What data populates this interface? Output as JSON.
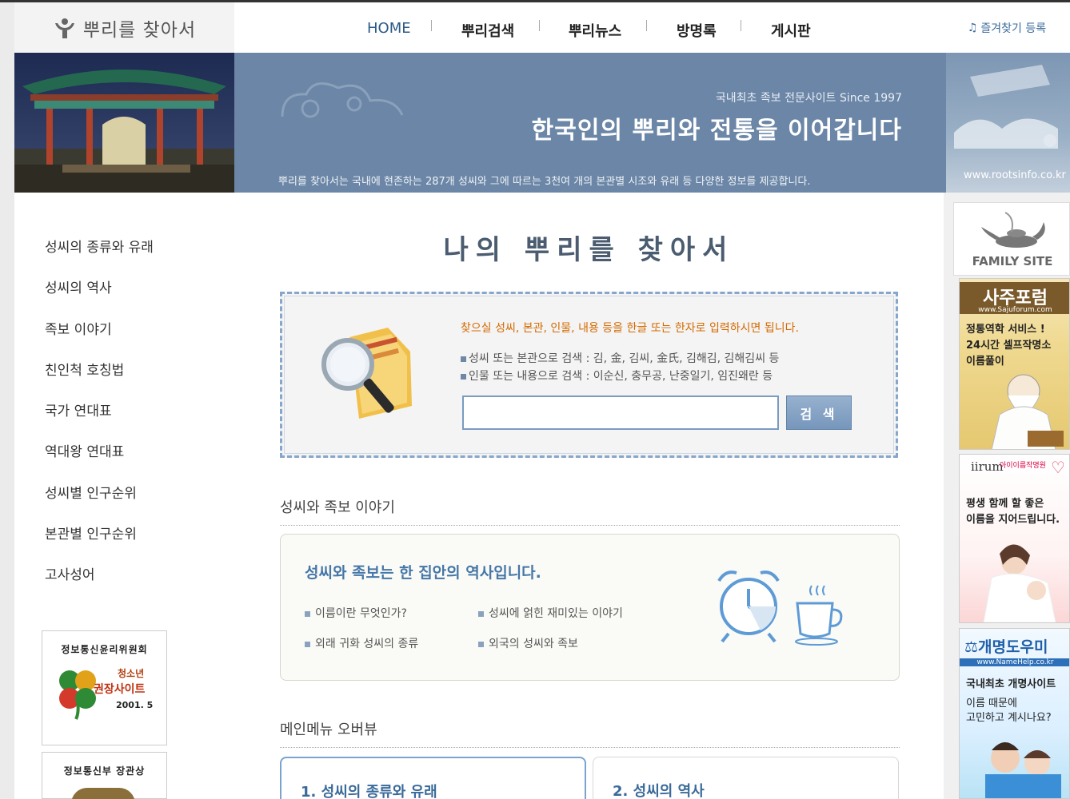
{
  "header": {
    "logo_text": "뿌리를 찾아서",
    "nav": [
      "HOME",
      "뿌리검색",
      "뿌리뉴스",
      "방명록",
      "게시판"
    ],
    "favorite_label": "즐겨찾기 등록"
  },
  "banner": {
    "subtitle": "국내최초 족보 전문사이트 Since 1997",
    "title": "한국인의 뿌리와 전통을 이어갑니다",
    "description": "뿌리를 찾아서는 국내에 현존하는 287개 성씨와 그에 따르는 3천여 개의 본관별 시조와 유래 등 다양한 정보를 제공합니다.",
    "url": "www.rootsinfo.co.kr"
  },
  "sidebar": {
    "items": [
      "성씨의 종류와 유래",
      "성씨의 역사",
      "족보 이야기",
      "친인척 호칭법",
      "국가 연대표",
      "역대왕 연대표",
      "성씨별 인구순위",
      "본관별 인구순위",
      "고사성어"
    ],
    "cert1": {
      "title": "정보통신윤리위원회",
      "line1": "청소년",
      "line2": "권장사이트",
      "date": "2001. 5"
    },
    "cert2": {
      "title": "정보통신부 장관상"
    }
  },
  "main": {
    "title": "나의 뿌리를 찾아서",
    "search": {
      "message": "찾으실 성씨, 본관, 인물, 내용 등을 한글 또는 한자로 입력하시면 됩니다.",
      "hint1": "성씨 또는 본관으로 검색 : 김, 金, 김씨, 金氏, 김해김, 김해김씨 등",
      "hint2": "인물 또는 내용으로 검색 : 이순신, 충무공, 난중일기, 임진왜란 등",
      "input_value": "",
      "button_label": "검 색"
    },
    "story": {
      "section_title": "성씨와 족보 이야기",
      "headline": "성씨와 족보는 한 집안의 역사입니다.",
      "links": [
        "이름이란 무엇인가?",
        "성씨에 얽힌 재미있는 이야기",
        "외래 귀화 성씨의 종류",
        "외국의 성씨와 족보"
      ]
    },
    "overview": {
      "section_title": "메인메뉴 오버뷰",
      "cards": [
        "1. 성씨의 종류와 유래",
        "2. 성씨의 역사"
      ]
    }
  },
  "right": {
    "family_label": "FAMILY SITE",
    "ad1": {
      "title": "사주포럼",
      "url": "www.Sajuforum.com",
      "line1": "정통역학 서비스 !",
      "line2": "24시간 셀프작명소",
      "line3": "이름풀이"
    },
    "ad2": {
      "brand": "iirum",
      "sub": "아이이름작명원",
      "line1": "평생 함께 할 좋은",
      "line2": "이름을 지어드립니다."
    },
    "ad3": {
      "title": "개명도우미",
      "url": "www.NameHelp.co.kr",
      "line1": "국내최초 개명사이트",
      "line2": "이름 때문에",
      "line3": "고민하고 계시나요?"
    }
  },
  "colors": {
    "accent": "#6b86a6",
    "link": "#3a6a9a",
    "notice": "#d46a00"
  }
}
